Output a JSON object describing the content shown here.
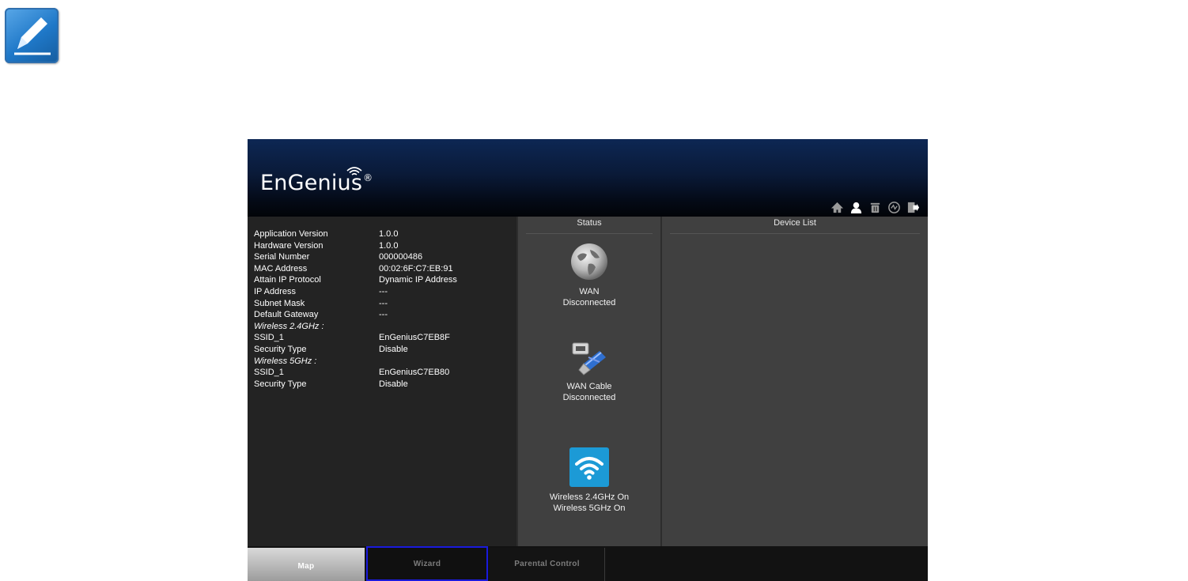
{
  "brand": {
    "name": "EnGenius",
    "registered": "®"
  },
  "top_icons": [
    "home-icon",
    "user-icon",
    "trash-icon",
    "power-icon",
    "logout-icon"
  ],
  "info": {
    "rows": [
      {
        "key": "Application Version",
        "value": "1.0.0",
        "section": false
      },
      {
        "key": "Hardware Version",
        "value": "1.0.0",
        "section": false
      },
      {
        "key": "Serial Number",
        "value": "000000486",
        "section": false
      },
      {
        "key": "MAC Address",
        "value": "00:02:6F:C7:EB:91",
        "section": false
      },
      {
        "key": "Attain IP Protocol",
        "value": "Dynamic IP Address",
        "section": false
      },
      {
        "key": "IP Address",
        "value": "---",
        "section": false
      },
      {
        "key": "Subnet Mask",
        "value": "---",
        "section": false
      },
      {
        "key": "Default Gateway",
        "value": "---",
        "section": false
      },
      {
        "key": "Wireless 2.4GHz :",
        "value": "",
        "section": true
      },
      {
        "key": "SSID_1",
        "value": "EnGeniusC7EB8F",
        "section": false
      },
      {
        "key": "Security Type",
        "value": "Disable",
        "section": false
      },
      {
        "key": "Wireless 5GHz :",
        "value": "",
        "section": true
      },
      {
        "key": "SSID_1",
        "value": "EnGeniusC7EB80",
        "section": false
      },
      {
        "key": "Security Type",
        "value": "Disable",
        "section": false
      }
    ]
  },
  "status": {
    "title": "Status",
    "wan": {
      "line1": "WAN",
      "line2": "Disconnected",
      "icon": "globe-icon"
    },
    "cable": {
      "line1": "WAN Cable",
      "line2": "Disconnected",
      "icon": "ethernet-cable-icon"
    },
    "wireless": {
      "line1": "Wireless 2.4GHz On",
      "line2": "Wireless 5GHz On",
      "icon": "wifi-icon"
    }
  },
  "device_list": {
    "title": "Device List"
  },
  "tabs": [
    {
      "id": "map",
      "label": "Map",
      "active": true
    },
    {
      "id": "wizard",
      "label": "Wizard",
      "active": false,
      "highlighted": true
    },
    {
      "id": "parental",
      "label": "Parental Control",
      "active": false
    }
  ],
  "colors": {
    "highlight_border": "#1a1adc",
    "header_dark": "#0a1a38",
    "wifi_tile": "#1c9ad6",
    "note_icon": "#1f78c8"
  }
}
